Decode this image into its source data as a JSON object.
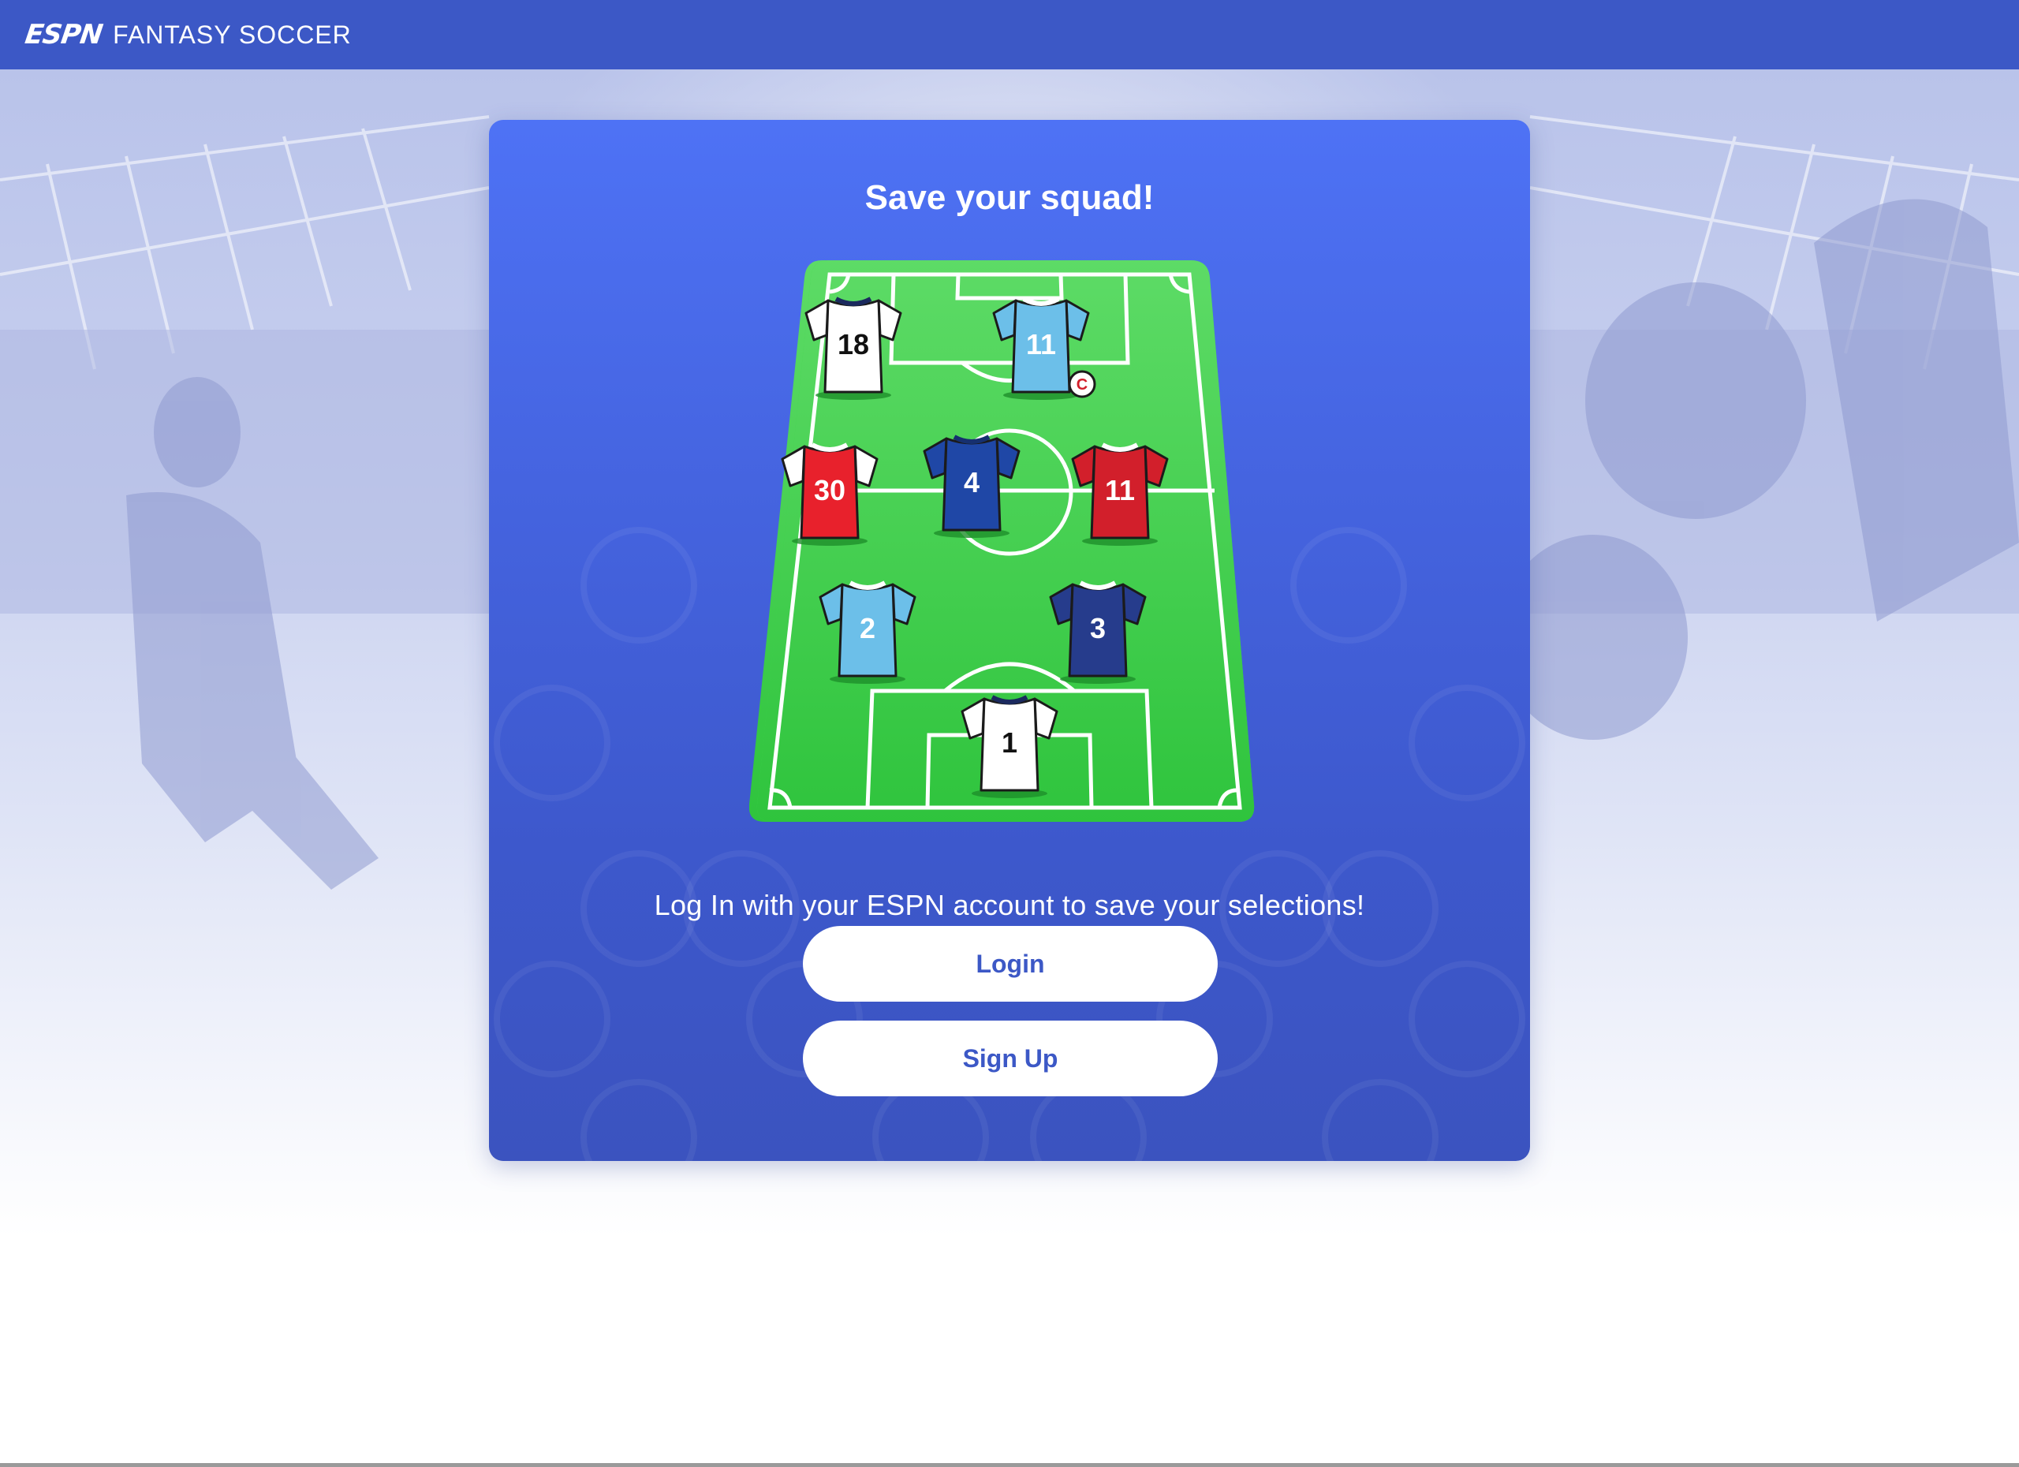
{
  "header": {
    "logo_mark": "ESPN",
    "product_name": "FANTASY SOCCER"
  },
  "card": {
    "title": "Save your squad!",
    "message": "Log In with your ESPN account to save your selections!",
    "login_label": "Login",
    "signup_label": "Sign Up"
  },
  "squad": [
    {
      "number": "18",
      "kit": "white-navy",
      "captain": false
    },
    {
      "number": "11",
      "kit": "sky-blue",
      "captain": true
    },
    {
      "number": "30",
      "kit": "red-white-sleeves",
      "captain": false
    },
    {
      "number": "4",
      "kit": "royal-blue",
      "captain": false
    },
    {
      "number": "11",
      "kit": "red",
      "captain": false
    },
    {
      "number": "2",
      "kit": "sky-blue",
      "captain": false
    },
    {
      "number": "3",
      "kit": "navy",
      "captain": false
    },
    {
      "number": "1",
      "kit": "white-navy",
      "captain": false
    }
  ],
  "captain_badge": "C",
  "colors": {
    "header": "#3c58c6",
    "card_top": "#4e72f5",
    "card_bottom": "#3b53bf",
    "pitch": "#3ccc4a",
    "button_text": "#3c58c6"
  }
}
